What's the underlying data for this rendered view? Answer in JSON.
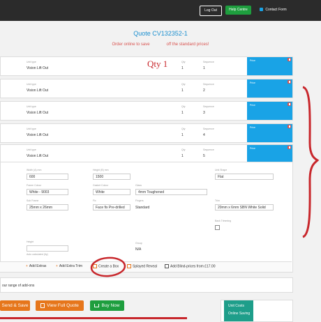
{
  "header": {
    "logout_label": "Log Out",
    "help_label": "Help Centre",
    "contact_label": "Contact Form",
    "contact_icon": "envelope-icon"
  },
  "quote": {
    "prefix": "Quote",
    "number": "CV132352-1",
    "promo_left": "Order online to save",
    "promo_right": "off the standard prices!"
  },
  "annotation": {
    "qty_text": "Qty 1"
  },
  "rows": [
    {
      "unit_type_label": "Unit type",
      "unit_type": "Vision Lift Out",
      "qty_label": "Qty",
      "qty": "1",
      "seq_label": "Sequence",
      "seq": "1",
      "panel_label": "Price"
    },
    {
      "unit_type_label": "Unit type",
      "unit_type": "Vision Lift Out",
      "qty_label": "Qty",
      "qty": "1",
      "seq_label": "Sequence",
      "seq": "2",
      "panel_label": "Price"
    },
    {
      "unit_type_label": "Unit type",
      "unit_type": "Vision Lift Out",
      "qty_label": "Qty",
      "qty": "1",
      "seq_label": "Sequence",
      "seq": "3",
      "panel_label": "Price"
    },
    {
      "unit_type_label": "Unit type",
      "unit_type": "Vision Lift Out",
      "qty_label": "Qty",
      "qty": "1",
      "seq_label": "Sequence",
      "seq": "4",
      "panel_label": "Price"
    },
    {
      "unit_type_label": "Unit type",
      "unit_type": "Vision Lift Out",
      "qty_label": "Qty",
      "qty": "1",
      "seq_label": "Sequence",
      "seq": "5",
      "panel_label": "Price"
    }
  ],
  "details": {
    "width_label": "Width (A) mm",
    "width_value": "600",
    "height_label": "Height (B) mm",
    "height_value": "1500",
    "unit_shape_label": "Unit Shape",
    "unit_shape_value": "Flat",
    "frame_colour_label": "Frame Colour",
    "frame_colour_value": "White - 9003",
    "gasket_colour_label": "Gasket Colour",
    "gasket_colour_value": "White",
    "glass_label": "Glass",
    "glass_value": "4mm Toughened",
    "sub_frame_label": "Sub Frame",
    "sub_frame_value": "25mm x 26mm",
    "fix_label": "Fix",
    "fix_value": "Face fix Pre-drilled",
    "fingers_label": "Fingers",
    "fingers_value": "Standard",
    "trim_label": "Trim",
    "trim_value": "20mm x 6mm SBN White Solid",
    "back_trimming_label": "Back Trimming",
    "height_b_label": "Height",
    "height_b_value": "",
    "note_label": "Auto calculated (ity)",
    "group_label": "Group",
    "group_value": "N/A"
  },
  "extras": {
    "add_extras": "Add Extras",
    "add_extra_trim": "Add Extra Trim",
    "create_a_box": "Create a Box",
    "splayed_reveal": "Splayed Reveal",
    "add_blind": "Add Blind-prices from £17.00"
  },
  "range_text": "our range of add-ons",
  "actions": {
    "send_save": "Send & Save",
    "view_full_quote": "View Full Quote",
    "buy_now": "Buy Now"
  },
  "side_panel": {
    "unit_costs": "Unit Costs",
    "online_saving": "Online Saving"
  },
  "colors": {
    "accent_blue": "#19a3e6",
    "orange": "#e6761b",
    "green": "#1e9e3e",
    "annotation_red": "#c8272c"
  }
}
